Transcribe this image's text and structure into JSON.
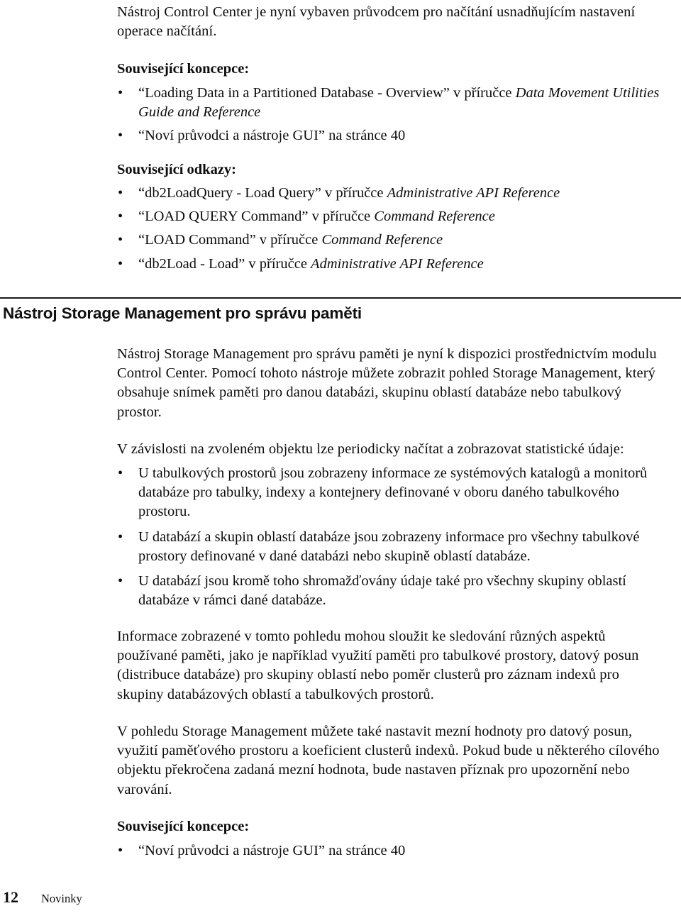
{
  "document": {
    "language": "cs",
    "intro_paragraph": "Nástroj Control Center je nyní vybaven průvodcem pro načítání usnadňujícím nastavení operace načítání.",
    "related_concepts_heading_1": "Související koncepce:",
    "related_concepts_items_1": [
      {
        "plain_before": "“Loading Data in a Partitioned Database - Overview” v  příručce ",
        "italic": "Data Movement Utilities Guide and Reference",
        "plain_after": ""
      },
      {
        "plain_before": "“Noví průvodci a  nástroje GUI” na  stránce 40",
        "italic": "",
        "plain_after": ""
      }
    ],
    "related_links_heading": "Související odkazy:",
    "related_links_items": [
      {
        "plain_before": "“db2LoadQuery - Load Query” v  příručce ",
        "italic": "Administrative API Reference",
        "plain_after": ""
      },
      {
        "plain_before": "“LOAD QUERY Command” v  příručce ",
        "italic": "Command Reference",
        "plain_after": ""
      },
      {
        "plain_before": "“LOAD Command” v  příručce ",
        "italic": "Command Reference",
        "plain_after": ""
      },
      {
        "plain_before": "“db2Load - Load” v  příručce ",
        "italic": "Administrative API Reference",
        "plain_after": ""
      }
    ],
    "section_heading": "Nástroj Storage Management pro správu paměti",
    "section_paragraph_1": "Nástroj Storage Management pro správu paměti je nyní k  dispozici prostřednictvím modulu Control Center. Pomocí tohoto nástroje můžete zobrazit pohled Storage Management, který obsahuje snímek paměti pro danou databázi, skupinu oblastí databáze nebo tabulkový prostor.",
    "section_paragraph_2": "V  závislosti na zvoleném objektu lze periodicky načítat a  zobrazovat statistické údaje:",
    "stat_bullets": [
      "U  tabulkových prostorů jsou zobrazeny informace ze systémových katalogů a  monitorů databáze pro tabulky, indexy a  kontejnery definované v  oboru daného tabulkového prostoru.",
      "U  databází a  skupin oblastí databáze jsou zobrazeny informace pro všechny tabulkové prostory definované v  dané databázi nebo skupině oblastí databáze.",
      "U  databází jsou kromě toho shromažďovány údaje také pro všechny skupiny oblastí databáze v  rámci dané databáze."
    ],
    "section_paragraph_3": "Informace zobrazené v  tomto pohledu mohou sloužit ke sledování různých aspektů používané paměti, jako je například využití paměti pro tabulkové prostory, datový posun (distribuce databáze) pro skupiny oblastí nebo poměr clusterů pro záznam indexů pro skupiny databázových oblastí a  tabulkových prostorů.",
    "section_paragraph_4": "V  pohledu Storage Management můžete také nastavit mezní hodnoty pro datový posun, využití paměťového prostoru a  koeficient clusterů indexů. Pokud bude u  některého cílového objektu překročena zadaná mezní hodnota, bude nastaven příznak pro upozornění nebo varování.",
    "related_concepts_heading_2": "Související koncepce:",
    "related_concepts_items_2": [
      {
        "plain_before": "“Noví průvodci a  nástroje GUI” na  stránce 40",
        "italic": "",
        "plain_after": ""
      }
    ],
    "bullet_glyph": "•",
    "footer": {
      "page_number": "12",
      "label": "Novinky"
    },
    "colors": {
      "text": "#0d0d0d",
      "rule": "#1a1a1a",
      "background": "#ffffff"
    }
  }
}
